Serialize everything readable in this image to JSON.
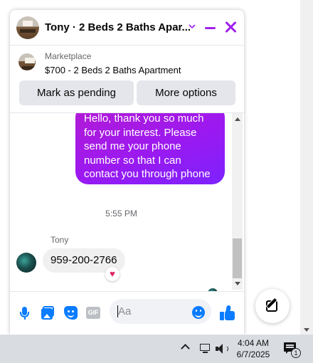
{
  "chat": {
    "title": "Tony · 2 Beds 2 Baths Apar...",
    "listing": {
      "source": "Marketplace",
      "title": "$700 - 2 Beds 2 Baths Apartment"
    },
    "buttons": {
      "mark_pending": "Mark as pending",
      "more_options": "More options"
    },
    "messages": {
      "outgoing_text": "Hello, thank you so much for your interest. Please send me your phone number so that I can contact you through phone",
      "timestamp": "5:55 PM",
      "sender_name": "Tony",
      "incoming_text": "959-200-2766",
      "reaction": "♥"
    },
    "composer": {
      "placeholder": "Aa",
      "gif_label": "GIF"
    },
    "accent_color": "#a020f0",
    "icon_color": "#0a7cff"
  },
  "taskbar": {
    "time": "4:04 AM",
    "date": "6/7/2025",
    "notification_count": "1"
  }
}
